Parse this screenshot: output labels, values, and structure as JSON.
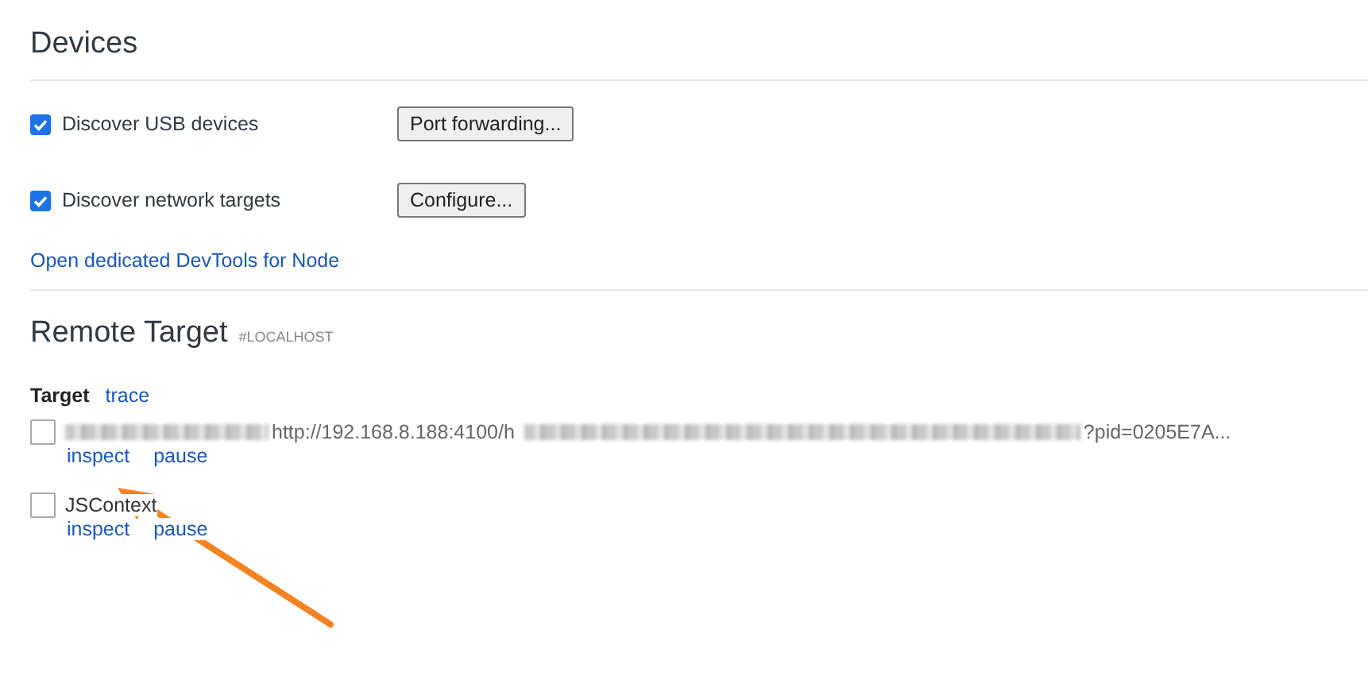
{
  "devices": {
    "title": "Devices",
    "options": [
      {
        "label": "Discover USB devices",
        "checked": true,
        "button": "Port forwarding..."
      },
      {
        "label": "Discover network targets",
        "checked": true,
        "button": "Configure..."
      }
    ],
    "link": "Open dedicated DevTools for Node"
  },
  "remote_target": {
    "title": "Remote Target",
    "host": "#LOCALHOST",
    "header": "Target",
    "header_link": "trace",
    "targets": [
      {
        "name_blurred": true,
        "url_start": "http://192.168.8.188:4100/h",
        "url_blurred": true,
        "url_end": "?pid=0205E7A...",
        "checked": false,
        "actions": [
          "inspect",
          "pause"
        ]
      },
      {
        "name": "JSContext",
        "checked": false,
        "actions": [
          "inspect",
          "pause"
        ]
      }
    ]
  },
  "annotation": {
    "kind": "arrow"
  }
}
